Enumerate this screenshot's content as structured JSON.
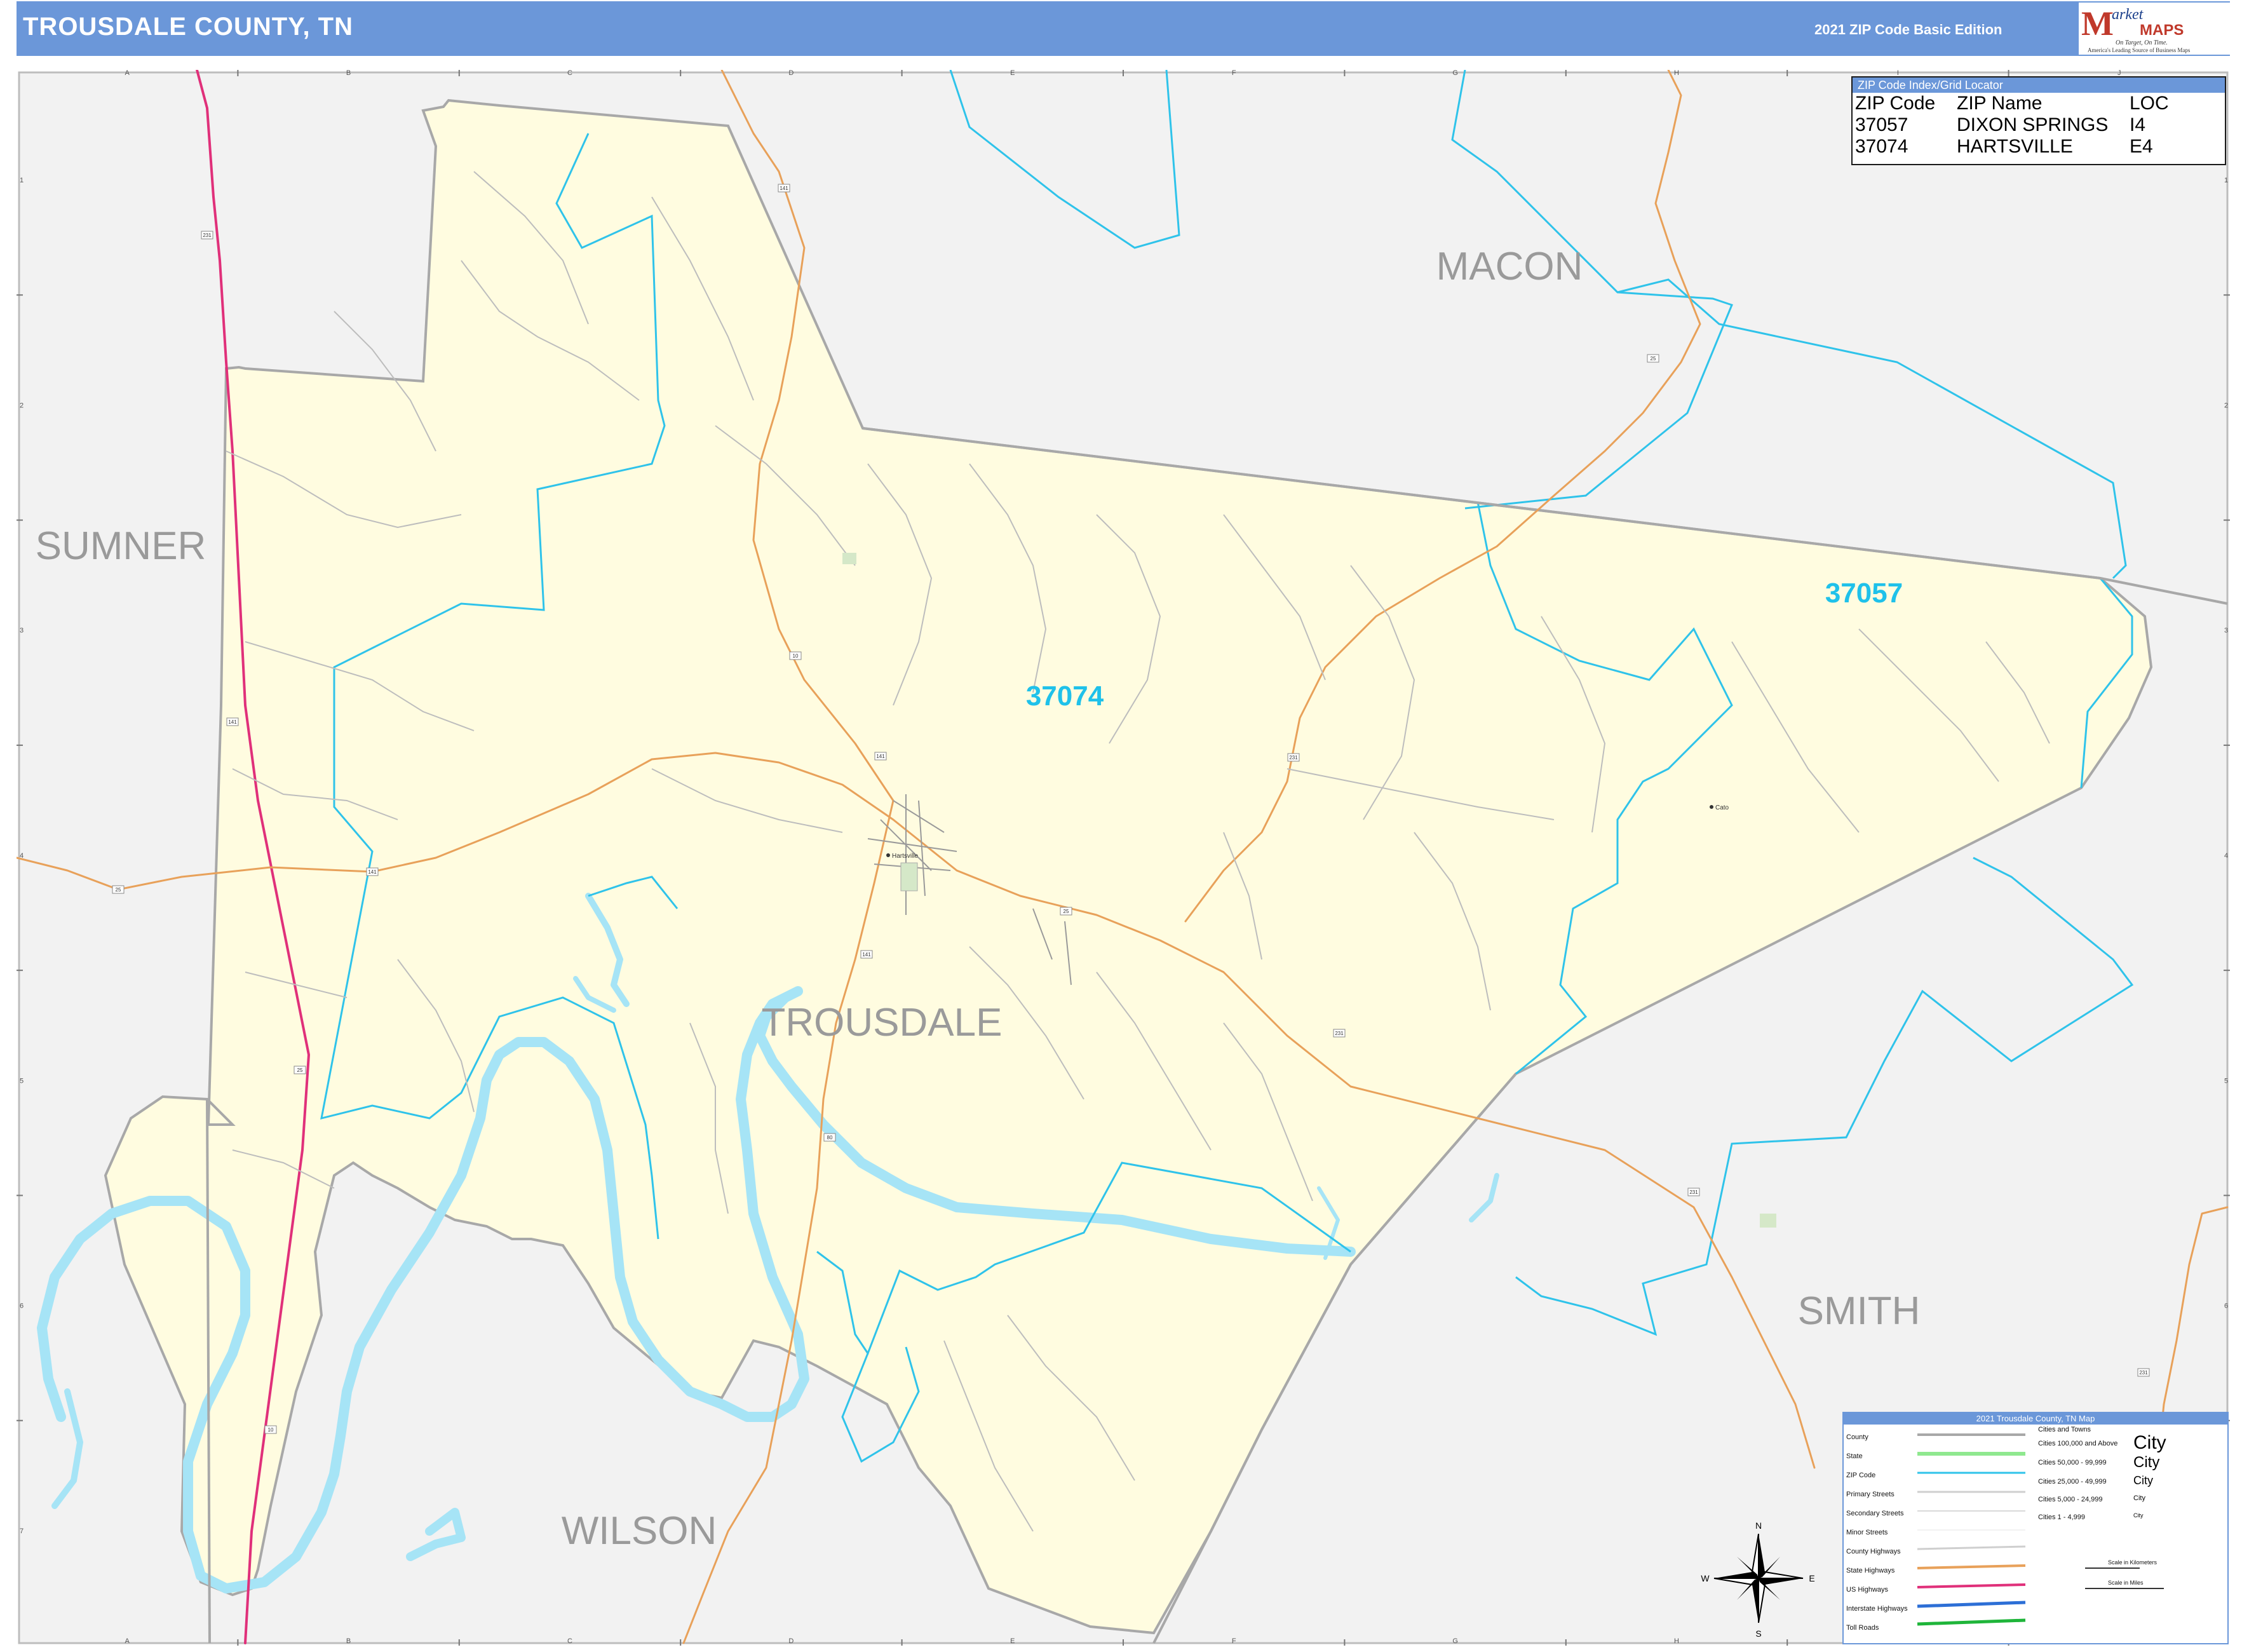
{
  "header": {
    "title": "TROUSDALE COUNTY, TN",
    "edition": "2021 ZIP Code Basic Edition",
    "logo_letter": "M",
    "logo_market": "arket",
    "logo_maps": "MAPS",
    "logo_tagline": "On Target, On Time.",
    "logo_subtitle": "America's Leading Source of Business Maps"
  },
  "grid": {
    "columns": [
      "A",
      "B",
      "C",
      "D",
      "E",
      "F",
      "G",
      "H",
      "I",
      "J"
    ],
    "rows": [
      "1",
      "2",
      "3",
      "4",
      "5",
      "6",
      "7"
    ]
  },
  "map": {
    "counties": [
      "MACON",
      "SUMNER",
      "TROUSDALE",
      "SMITH",
      "WILSON"
    ],
    "zip_codes": [
      "37074",
      "37057"
    ],
    "towns": [
      "Hartsville",
      "Cato"
    ],
    "highway_shields": [
      "231",
      "25",
      "141",
      "10",
      "141",
      "141",
      "25",
      "141",
      "80",
      "25",
      "231",
      "231",
      "231",
      "231",
      "141",
      "25",
      "10"
    ],
    "colors": {
      "county_fill": "#fffce0",
      "outside_fill": "#f2f2f2",
      "county_border": "#a8a8a8",
      "zip_border": "#2fc3ea",
      "water": "#a6e4f6",
      "state_highway": "#e8a15a",
      "us_highway": "#e0307a",
      "minor_street": "#bdbdbd"
    }
  },
  "zip_index": {
    "title": "ZIP Code Index/Grid Locator",
    "columns": [
      "ZIP Code",
      "ZIP Name",
      "LOC"
    ],
    "rows": [
      [
        "37057",
        "DIXON SPRINGS",
        "I4"
      ],
      [
        "37074",
        "HARTSVILLE",
        "E4"
      ]
    ]
  },
  "legend": {
    "title": "2021 Trousdale County, TN Map",
    "items": [
      "County",
      "State",
      "ZIP Code",
      "Primary Streets",
      "Secondary Streets",
      "Minor Streets",
      "County Highways",
      "State Highways",
      "US Highways",
      "Interstate Highways",
      "Toll Roads"
    ],
    "cities_title": "Cities and Towns",
    "cities": [
      {
        "range": "Cities 100,000 and Above",
        "sample": "City"
      },
      {
        "range": "Cities 50,000 - 99,999",
        "sample": "City"
      },
      {
        "range": "Cities 25,000 - 49,999",
        "sample": "City"
      },
      {
        "range": "Cities 5,000 - 24,999",
        "sample": "City"
      },
      {
        "range": "Cities 1 - 4,999",
        "sample": "City"
      }
    ],
    "scale_km": "Scale in Kilometers",
    "scale_miles": "Scale in Miles"
  },
  "compass": {
    "n": "N",
    "s": "S",
    "e": "E",
    "w": "W"
  }
}
